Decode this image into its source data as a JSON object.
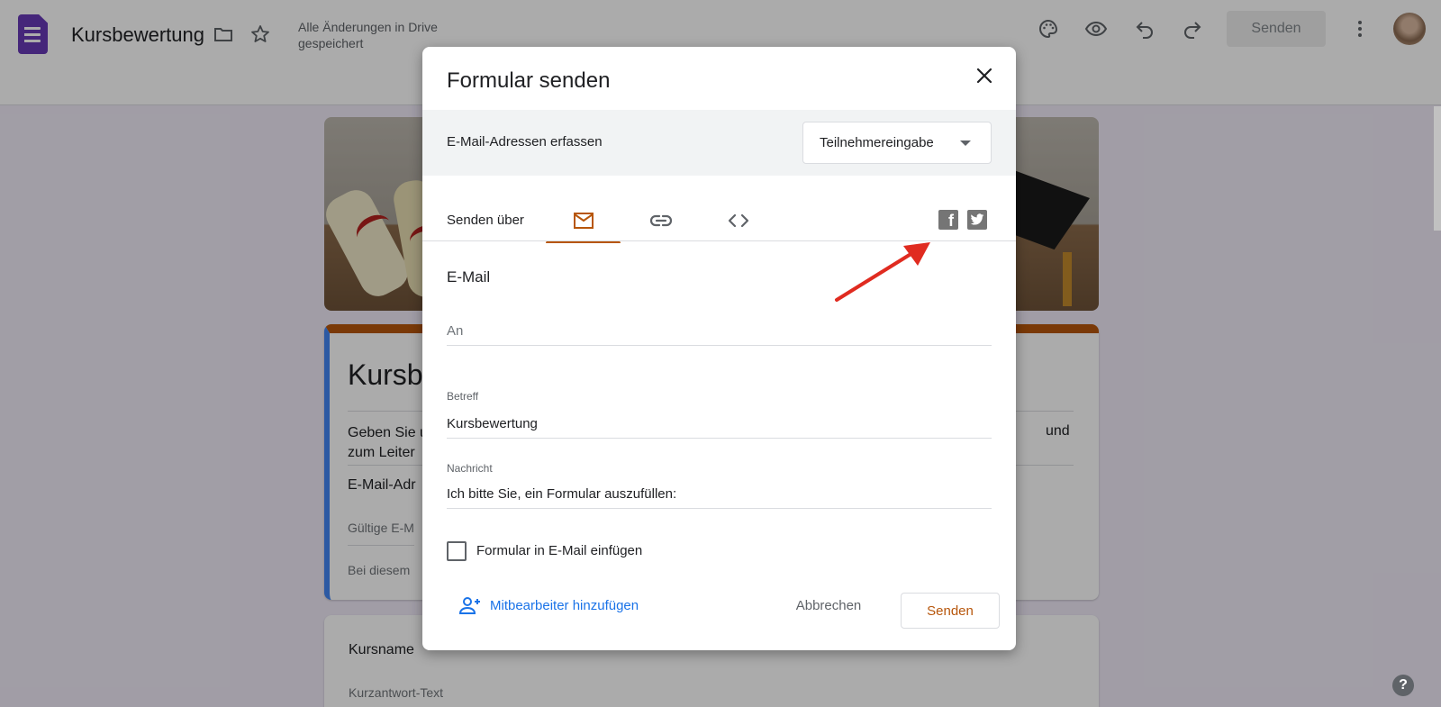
{
  "app": {
    "doc_title": "Kursbewertung",
    "save_status": "Alle Änderungen in Drive gespeichert",
    "send_button": "Senden"
  },
  "form_background": {
    "title": "Kursb",
    "description": "Geben Sie u",
    "description_line2": "zum Leiter",
    "description_right": "und",
    "email_label": "E-Mail-Adr",
    "email_placeholder": "Gültige E-M",
    "note": "Bei diesem",
    "question_title": "Kursname",
    "question_placeholder": "Kurzantwort-Text"
  },
  "dialog": {
    "title": "Formular senden",
    "collect_label": "E-Mail-Adressen erfassen",
    "collect_value": "Teilnehmereingabe",
    "send_via_label": "Senden über",
    "tabs": [
      {
        "label": "E-Mail",
        "icon": "mail-icon",
        "active": true
      },
      {
        "label": "Link",
        "icon": "link-icon",
        "active": false
      },
      {
        "label": "HTML einbetten",
        "icon": "code-icon",
        "active": false
      }
    ],
    "social": [
      {
        "icon": "facebook-icon",
        "glyph": "f"
      },
      {
        "icon": "twitter-icon"
      }
    ],
    "section_title": "E-Mail",
    "to_placeholder": "An",
    "subject_label": "Betreff",
    "subject_value": "Kursbewertung",
    "message_label": "Nachricht",
    "message_value": "Ich bitte Sie, ein Formular auszufüllen:",
    "include_form_label": "Formular in E-Mail einfügen",
    "include_form_checked": false,
    "add_collaborators": "Mitbearbeiter hinzufügen",
    "cancel": "Abbrechen",
    "send": "Senden"
  },
  "colors": {
    "accent": "#b7560b",
    "link_blue": "#1a73e8",
    "forms_purple": "#673ab7",
    "annotation_red": "#e02b20"
  },
  "help": "?"
}
